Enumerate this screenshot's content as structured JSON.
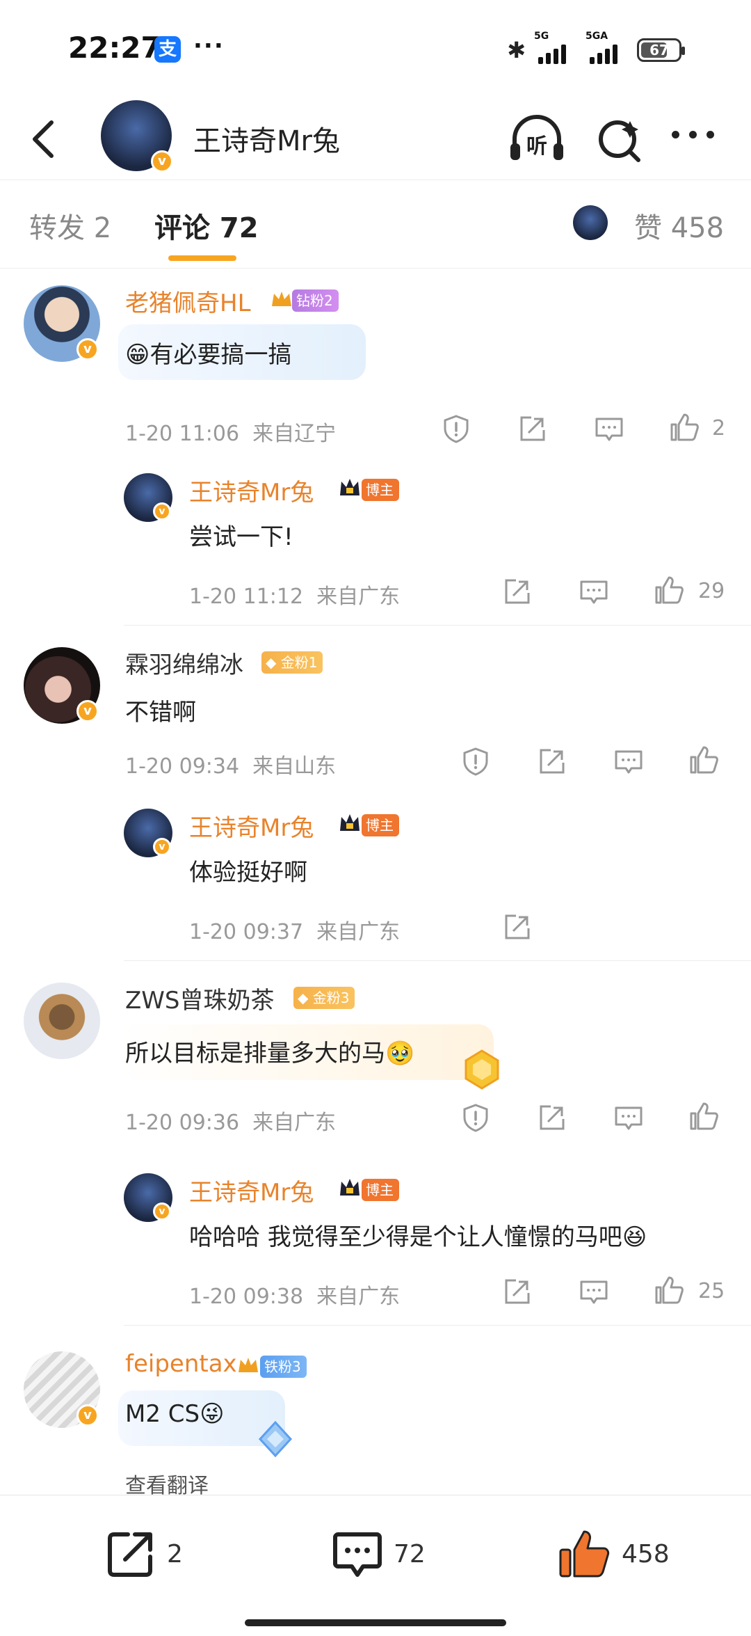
{
  "status_bar": {
    "time": "22:27",
    "app_icon": "支",
    "more": "···",
    "net1": "5G",
    "net2": "5GA",
    "battery": "67"
  },
  "header": {
    "title": "王诗奇Mr兔",
    "listen_label": "听"
  },
  "tabs": {
    "repost": "转发 2",
    "comment": "评论 72",
    "likes": "赞 458"
  },
  "comments": [
    {
      "user": "老猪佩奇HL",
      "badge": "钻粉2",
      "text": "有必要搞一搞",
      "time": "1-20 11:06",
      "location": "来自辽宁",
      "likes": "2",
      "reply": {
        "user": "王诗奇Mr兔",
        "badge": "博主",
        "text": "尝试一下!",
        "time": "1-20 11:12",
        "location": "来自广东",
        "likes": "29"
      }
    },
    {
      "user": "霖羽绵绵冰",
      "badge": "金粉1",
      "text": "不错啊",
      "time": "1-20 09:34",
      "location": "来自山东",
      "likes": "",
      "reply": {
        "user": "王诗奇Mr兔",
        "badge": "博主",
        "text": "体验挺好啊",
        "time": "1-20 09:37",
        "location": "来自广东",
        "likes": ""
      }
    },
    {
      "user": "ZWS曾珠奶茶",
      "badge": "金粉3",
      "text": "所以目标是排量多大的马",
      "time": "1-20 09:36",
      "location": "来自广东",
      "likes": "",
      "reply": {
        "user": "王诗奇Mr兔",
        "badge": "博主",
        "text": "哈哈哈 我觉得至少得是个让人憧憬的马吧",
        "time": "1-20 09:38",
        "location": "来自广东",
        "likes": "25"
      }
    },
    {
      "user": "feipentax",
      "badge": "铁粉3",
      "text": "M2 CS",
      "translate": "查看翻译"
    }
  ],
  "bottom_bar": {
    "reposts": "2",
    "comments": "72",
    "likes": "458"
  },
  "colors": {
    "accent": "#f7a521",
    "username": "#e8832b",
    "like_active": "#f0752e"
  }
}
